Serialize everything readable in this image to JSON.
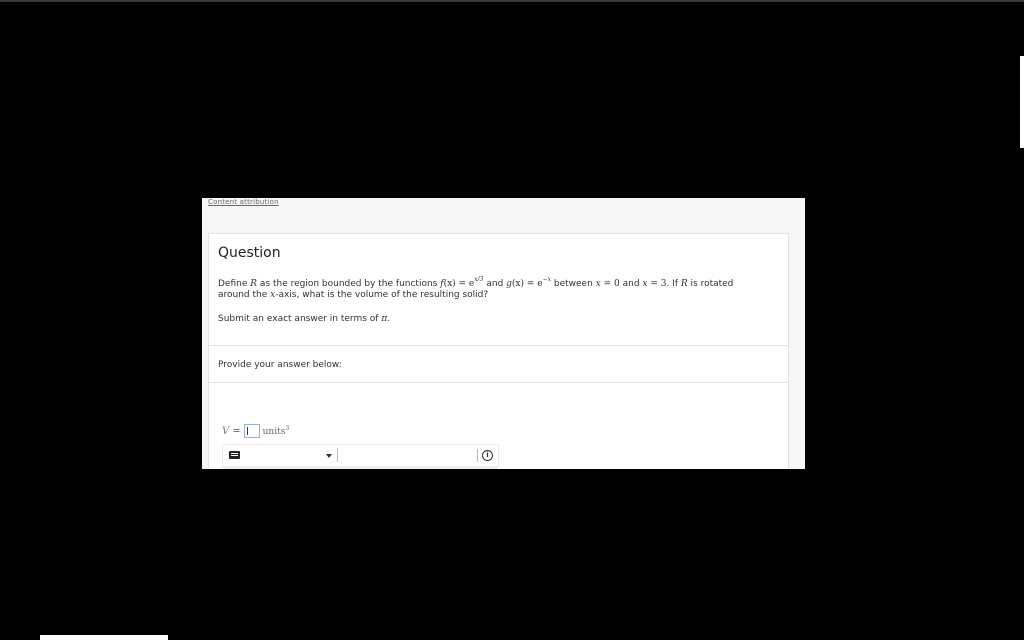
{
  "attribution": {
    "link": "Content attribution"
  },
  "question": {
    "title": "Question",
    "line1": {
      "p1": "Define ",
      "R": "R",
      "p2": " as the region bounded by the functions ",
      "f": "f",
      "x_paren": "(x) = e",
      "f_exp": "x/3",
      "p3": " and ",
      "g": "g",
      "g_paren": "(x) = e",
      "g_exp": "−x",
      "p4": " between ",
      "x1": "x",
      "eq0": " = 0",
      "p5": " and ",
      "x2": "x",
      "eq3": " = 3",
      "p6": ". If ",
      "R2": "R",
      "p7": " is rotated"
    },
    "line2": {
      "p1": "around the ",
      "x": "x",
      "p2": "-axis, what is the volume of the resulting solid?"
    },
    "line3": {
      "p1": "Submit an exact answer in terms of ",
      "pi": "π",
      "p2": "."
    }
  },
  "answer": {
    "prompt": "Provide your answer below:",
    "variable": "V",
    "equals": "=",
    "units": "units",
    "units_exp": "3",
    "value": ""
  },
  "toolbar": {
    "keyboard_icon": "keyboard-icon",
    "dropdown_icon": "chevron-down-icon",
    "info_icon": "info-icon",
    "info_glyph": "i"
  }
}
